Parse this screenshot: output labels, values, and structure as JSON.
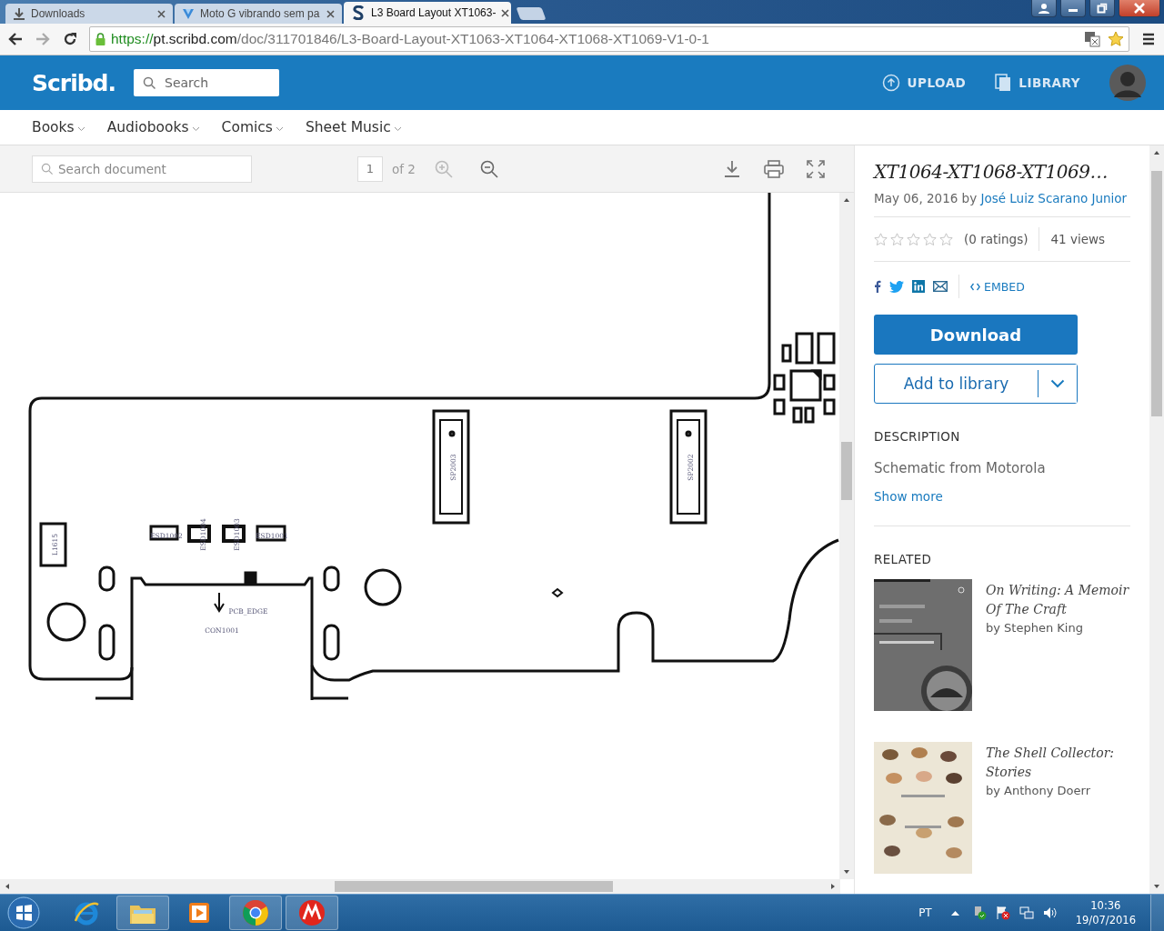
{
  "browser": {
    "tabs": [
      {
        "title": "Downloads",
        "selected": false
      },
      {
        "title": "Moto G vibrando sem pa",
        "selected": false
      },
      {
        "title": "L3 Board Layout XT1063-",
        "selected": true
      }
    ],
    "url": {
      "scheme": "https://",
      "host": "pt.scribd.com",
      "path": "/doc/311701846/L3-Board-Layout-XT1063-XT1064-XT1068-XT1069-V1-0-1"
    }
  },
  "header": {
    "logo": "Scribd.",
    "search_placeholder": "Search",
    "upload": "UPLOAD",
    "library": "LIBRARY"
  },
  "nav": [
    {
      "label": "Books"
    },
    {
      "label": "Audiobooks"
    },
    {
      "label": "Comics"
    },
    {
      "label": "Sheet Music"
    }
  ],
  "viewer": {
    "search_placeholder": "Search document",
    "page": "1",
    "page_count": "of 2",
    "labels": [
      "SP2003",
      "SP2002",
      "L1615",
      "ESD1002",
      "ESD1004",
      "ESD1003",
      "ESD1001",
      "PCB_EDGE",
      "CON1001"
    ]
  },
  "document": {
    "title": "XT1064-XT1068-XT1069…",
    "date": "May 06, 2016",
    "by_word": "by",
    "author": "José Luiz Scarano Junior",
    "stars": 0,
    "ratings": "(0 ratings)",
    "views": "41 views",
    "embed": "EMBED",
    "download": "Download",
    "add_to_library": "Add to library",
    "description_heading": "DESCRIPTION",
    "description": "Schematic from Motorola",
    "show_more": "Show more",
    "related_heading": "RELATED",
    "related": [
      {
        "title": "On Writing: A Memoir Of The Craft",
        "author": "by Stephen King"
      },
      {
        "title": "The Shell Collector: Stories",
        "author": "by Anthony Doerr"
      }
    ]
  },
  "taskbar": {
    "language": "PT",
    "time": "10:36",
    "date": "19/07/2016"
  }
}
